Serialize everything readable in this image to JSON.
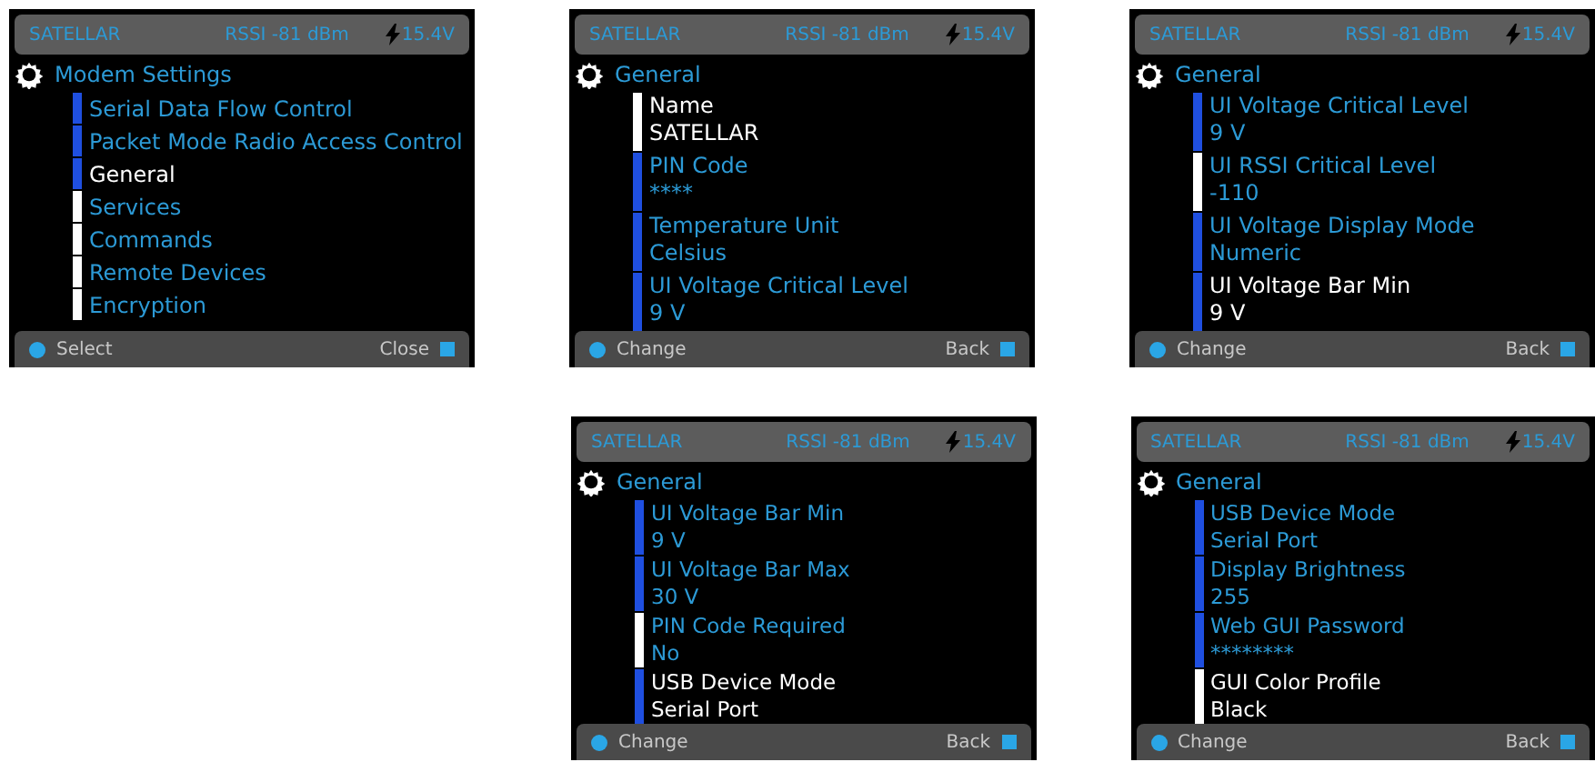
{
  "screens": [
    {
      "status": {
        "device": "SATELLAR",
        "rssi": "RSSI -81 dBm",
        "voltage": "15.4V"
      },
      "title": "Modem Settings",
      "items": [
        {
          "label": "Serial Data Flow Control",
          "selected": false,
          "bar_lit": false
        },
        {
          "label": "Packet Mode Radio Access Control",
          "selected": false,
          "bar_lit": false
        },
        {
          "label": "General",
          "selected": true,
          "bar_lit": false
        },
        {
          "label": "Services",
          "selected": false,
          "bar_lit": true
        },
        {
          "label": "Commands",
          "selected": false,
          "bar_lit": true
        },
        {
          "label": "Remote Devices",
          "selected": false,
          "bar_lit": true
        },
        {
          "label": "Encryption",
          "selected": false,
          "bar_lit": true
        }
      ],
      "footer": {
        "left": "Select",
        "right": "Close"
      }
    },
    {
      "status": {
        "device": "SATELLAR",
        "rssi": "RSSI -81 dBm",
        "voltage": "15.4V"
      },
      "title": "General",
      "items": [
        {
          "label": "Name",
          "value": "SATELLAR",
          "selected": true,
          "bar_lit": true
        },
        {
          "label": "PIN Code",
          "value": "****",
          "selected": false,
          "bar_lit": false
        },
        {
          "label": "Temperature Unit",
          "value": "Celsius",
          "selected": false,
          "bar_lit": false
        },
        {
          "label": "UI Voltage Critical Level",
          "value": "9 V",
          "selected": false,
          "bar_lit": false
        }
      ],
      "footer": {
        "left": "Change",
        "right": "Back"
      }
    },
    {
      "status": {
        "device": "SATELLAR",
        "rssi": "RSSI -81 dBm",
        "voltage": "15.4V"
      },
      "title": "General",
      "items": [
        {
          "label": "UI Voltage Critical Level",
          "value": "9 V",
          "selected": false,
          "bar_lit": false
        },
        {
          "label": "UI RSSI Critical Level",
          "value": "-110",
          "selected": false,
          "bar_lit": true
        },
        {
          "label": "UI Voltage Display Mode",
          "value": "Numeric",
          "selected": false,
          "bar_lit": false
        },
        {
          "label": "UI Voltage Bar Min",
          "value": "9 V",
          "selected": true,
          "bar_lit": false
        }
      ],
      "footer": {
        "left": "Change",
        "right": "Back"
      }
    },
    {
      "status": {
        "device": "SATELLAR",
        "rssi": "RSSI -81 dBm",
        "voltage": "15.4V"
      },
      "title": "General",
      "items": [
        {
          "label": "UI Voltage Bar Min",
          "value": "9 V",
          "selected": false,
          "bar_lit": false
        },
        {
          "label": "UI Voltage Bar Max",
          "value": "30 V",
          "selected": false,
          "bar_lit": false
        },
        {
          "label": "PIN Code Required",
          "value": "No",
          "selected": false,
          "bar_lit": true
        },
        {
          "label": "USB Device Mode",
          "value": "Serial Port",
          "selected": true,
          "bar_lit": false
        }
      ],
      "footer": {
        "left": "Change",
        "right": "Back"
      }
    },
    {
      "status": {
        "device": "SATELLAR",
        "rssi": "RSSI -81 dBm",
        "voltage": "15.4V"
      },
      "title": "General",
      "items": [
        {
          "label": "USB Device Mode",
          "value": "Serial Port",
          "selected": false,
          "bar_lit": false
        },
        {
          "label": "Display Brightness",
          "value": "255",
          "selected": false,
          "bar_lit": false
        },
        {
          "label": "Web GUI Password",
          "value": "********",
          "selected": false,
          "bar_lit": false
        },
        {
          "label": "GUI Color Profile",
          "value": "Black",
          "selected": true,
          "bar_lit": true
        }
      ],
      "footer": {
        "left": "Change",
        "right": "Back"
      }
    }
  ]
}
